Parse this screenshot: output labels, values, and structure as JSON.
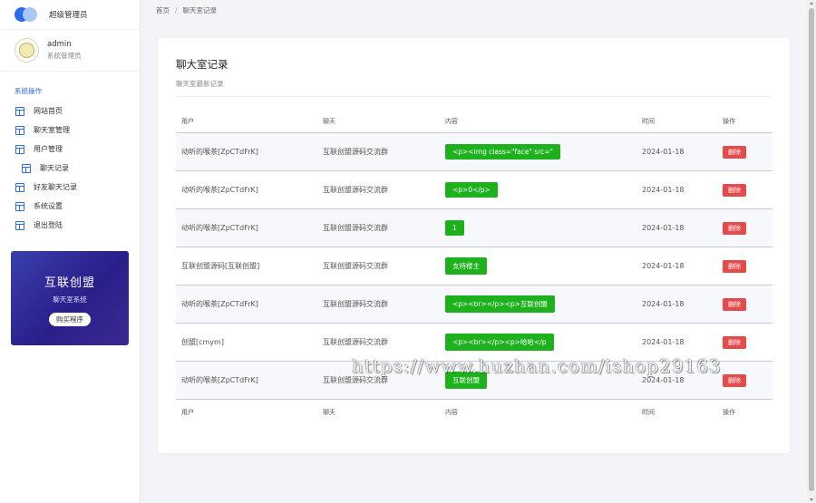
{
  "brand": {
    "title": "超级管理员"
  },
  "user": {
    "name": "admin",
    "role": "系统管理员"
  },
  "sidebar": {
    "section_label": "系统操作",
    "items": [
      {
        "label": "网站首页",
        "sub": false
      },
      {
        "label": "聊天室管理",
        "sub": false
      },
      {
        "label": "用户管理",
        "sub": false
      },
      {
        "label": "聊天记录",
        "sub": true
      },
      {
        "label": "好友聊天记录",
        "sub": false
      },
      {
        "label": "系统设置",
        "sub": false
      },
      {
        "label": "退出登陆",
        "sub": false
      }
    ]
  },
  "promo": {
    "title": "互联创盟",
    "subtitle": "聊天室系统",
    "button": "购买程序"
  },
  "breadcrumb": {
    "home": "首页",
    "sep": "/",
    "current": "聊天室记录"
  },
  "card": {
    "title": "聊大室记录",
    "subtitle": "聊天室最新记录"
  },
  "table": {
    "headers": {
      "user": "用户",
      "chat": "聊天",
      "content": "内容",
      "time": "时间",
      "op": "操作"
    },
    "rows": [
      {
        "user": "动听的喉茶[ZpCTdFrK]",
        "chat": "互联创盟源码交流群",
        "content": "<p><img class=\"face\" src=\"",
        "time": "2024-01-18",
        "op": "删除"
      },
      {
        "user": "动听的喉茶[ZpCTdFrK]",
        "chat": "互联创盟源码交流群",
        "content": "<p>0</p>",
        "time": "2024-01-18",
        "op": "删除"
      },
      {
        "user": "动听的喉茶[ZpCTdFrK]",
        "chat": "互联创盟源码交流群",
        "content": "1",
        "time": "2024-01-18",
        "op": "删除"
      },
      {
        "user": "互联创盟源码[互联创盟]",
        "chat": "互联创盟源码交流群",
        "content": "支持楼主",
        "time": "2024-01-18",
        "op": "删除"
      },
      {
        "user": "动听的喉茶[ZpCTdFrK]",
        "chat": "互联创盟源码交流群",
        "content": "<p><br></p><p>互联创盟",
        "time": "2024-01-18",
        "op": "删除"
      },
      {
        "user": "创盟[cmym]",
        "chat": "互联创盟源码交流群",
        "content": "<p><br></p><p>哈哈</p",
        "time": "2024-01-18",
        "op": "删除"
      },
      {
        "user": "动听的喉茶[ZpCTdFrK]",
        "chat": "互联创盟源码交流群",
        "content": "互联创盟",
        "time": "2024-01-18",
        "op": "删除"
      }
    ]
  },
  "watermark": "https://www.huzhan.com/ishop29163"
}
